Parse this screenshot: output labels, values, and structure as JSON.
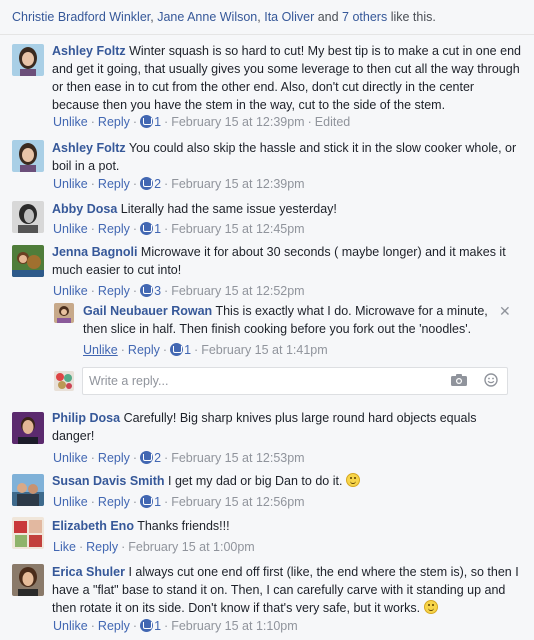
{
  "likes": {
    "names": [
      "Christie Bradford Winkler",
      "Jane Anne Wilson",
      "Ita Oliver",
      "7 others"
    ],
    "sep1": ", ",
    "sep2": ", ",
    "sep3": " and ",
    "suffix": " like this."
  },
  "comments": [
    {
      "author": "Ashley Foltz",
      "text": "Winter squash is so hard to cut! My best tip is to make a cut in one end and get it going, that usually gives you some leverage to then cut all the way through or then ease in to cut from the other end. Also, don't cut directly in the center because then you have the stem in the way, cut to the side of the stem.",
      "action": "Unlike",
      "reply": "Reply",
      "likes": "1",
      "time": "February 15 at 12:39pm",
      "extra": "Edited"
    },
    {
      "author": "Ashley Foltz",
      "text": "You could also skip the hassle and stick it in the slow cooker whole, or boil in a pot.",
      "action": "Unlike",
      "reply": "Reply",
      "likes": "2",
      "time": "February 15 at 12:39pm"
    },
    {
      "author": "Abby Dosa",
      "text": "Literally had the same issue yesterday!",
      "action": "Unlike",
      "reply": "Reply",
      "likes": "1",
      "time": "February 15 at 12:45pm"
    },
    {
      "author": "Jenna Bagnoli",
      "text": "Microwave it for about 30 seconds ( maybe longer) and it makes it much easier to cut into!",
      "action": "Unlike",
      "reply": "Reply",
      "likes": "3",
      "time": "February 15 at 12:52pm"
    },
    {
      "author": "Gail Neubauer Rowan",
      "text": "This is exactly what I do. Microwave for a minute, then slice in half. Then finish cooking before you fork out the 'noodles'.",
      "action": "Unlike",
      "reply": "Reply",
      "likes": "1",
      "time": "February 15 at 1:41pm"
    },
    {
      "author": "Philip Dosa",
      "text": "Carefully! Big sharp knives plus large round hard objects equals danger!",
      "action": "Unlike",
      "reply": "Reply",
      "likes": "2",
      "time": "February 15 at 12:53pm"
    },
    {
      "author": "Susan Davis Smith",
      "text": "I get my dad or big Dan to do it.",
      "action": "Unlike",
      "reply": "Reply",
      "likes": "1",
      "time": "February 15 at 12:56pm"
    },
    {
      "author": "Elizabeth Eno",
      "text": "Thanks friends!!!",
      "action": "Like",
      "reply": "Reply",
      "time": "February 15 at 1:00pm"
    },
    {
      "author": "Erica Shuler",
      "text": "I always cut one end off first (like, the end where the stem is), so then I have a \"flat\" base to stand it on. Then, I can carefully carve with it standing up and then rotate it on its side. Don't know if that's very safe, but it works.",
      "action": "Unlike",
      "reply": "Reply",
      "likes": "1",
      "time": "February 15 at 1:10pm"
    }
  ],
  "reply_box": {
    "placeholder": "Write a reply..."
  },
  "icons": {
    "like": "thumbs-up-icon",
    "close": "close-icon",
    "camera": "camera-icon",
    "emoji": "smiley-icon"
  },
  "colors": {
    "link": "#365899",
    "action": "#4267b2",
    "meta": "#90949c",
    "bg": "#f6f7f9"
  }
}
